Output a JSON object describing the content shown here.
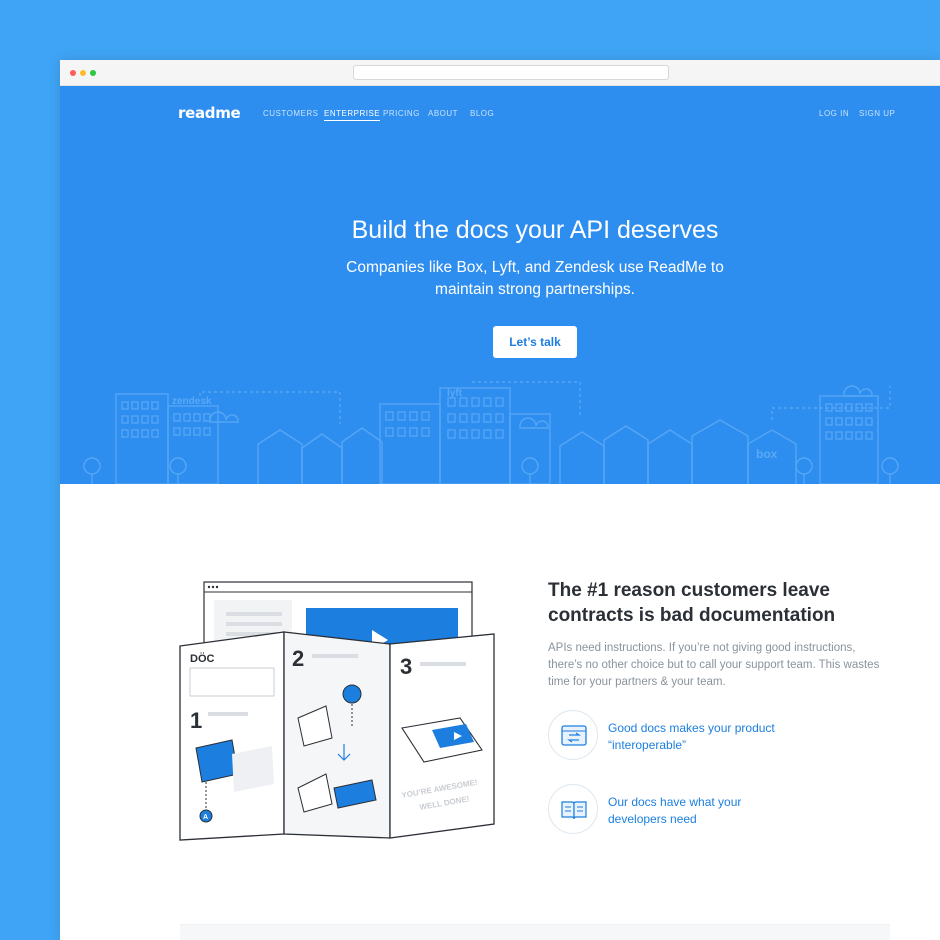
{
  "browser": {
    "dots": [
      "red-dot",
      "yellow-dot",
      "green-dot"
    ],
    "url": ""
  },
  "nav": {
    "logo": "readme",
    "links": [
      "CUSTOMERS",
      "ENTERPRISE",
      "PRICING",
      "ABOUT",
      "BLOG"
    ],
    "active": "ENTERPRISE",
    "right_links": [
      "LOG IN",
      "SIGN UP"
    ]
  },
  "hero": {
    "title": "Build the docs your API deserves",
    "subtitle": "Companies like Box, Lyft, and Zendesk use ReadMe to maintain strong partnerships.",
    "cta": "Let’s talk",
    "skyline_logos": [
      "zendesk",
      "lyft",
      "box"
    ]
  },
  "section": {
    "title": "The #1 reason customers leave contracts is bad documentation",
    "body": "APIs need instructions. If you’re not giving good instructions, there’s no other choice but to call your support team. This wastes time for your partners & your team.",
    "features": [
      {
        "icon": "interoperable-icon",
        "text": "Good docs makes your product “interoperable”"
      },
      {
        "icon": "open-book-icon",
        "text": "Our docs have what your developers need"
      }
    ],
    "illustration": {
      "brand": "DÖC",
      "steps": [
        "1",
        "2",
        "3"
      ],
      "tagline_line1": "YOU’RE AWESOME!",
      "tagline_line2": "WELL DONE!",
      "badge": "A"
    }
  },
  "colors": {
    "background": "#3fa4f5",
    "hero": "#2e8ef0",
    "accent": "#1c7fe0",
    "title_text": "#2b2f36",
    "body_text": "#8a939c"
  }
}
